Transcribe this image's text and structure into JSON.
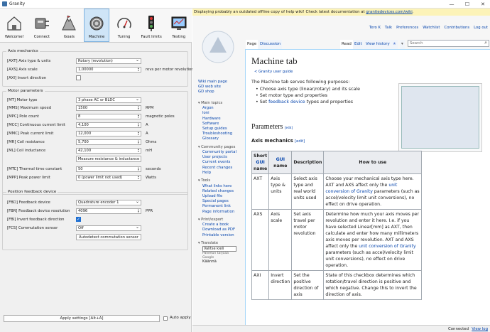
{
  "window": {
    "title": "Granity",
    "minimize": "—",
    "maximize": "☐",
    "close": "✕"
  },
  "toolbar": [
    {
      "label": "Welcome!",
      "icon": "welcome-icon"
    },
    {
      "label": "Connect",
      "icon": "connect-icon"
    },
    {
      "label": "Goals",
      "icon": "goals-icon"
    },
    {
      "label": "Machine",
      "icon": "machine-icon",
      "active": true
    },
    {
      "label": "Tuning",
      "icon": "tuning-icon"
    },
    {
      "label": "Fault limits",
      "icon": "traffic-light-icon"
    },
    {
      "label": "Testing",
      "icon": "testing-icon"
    }
  ],
  "axis": {
    "title": "Axis mechanics",
    "axt_label": "[AXT] Axis type & units",
    "axt_value": "Rotary (revolution)",
    "axs_label": "[AXS] Axis scale",
    "axs_value": "1,00000",
    "axs_unit": "revs per motor revolution",
    "axi_label": "[AXI] Invert direction"
  },
  "motor": {
    "title": "Motor parameters",
    "mt_label": "[MT] Motor type",
    "mt_value": "3 phase AC or BLDC",
    "mms_label": "[MMS] Maximum speed",
    "mms_value": "1500",
    "mms_unit": "RPM",
    "mpc_label": "[MPC] Pole count",
    "mpc_value": "8",
    "mpc_unit": "magnetic poles",
    "mcc_label": "[MCC] Continuous current limit",
    "mcc_value": "4,100",
    "mcc_unit": "A",
    "mmc_label": "[MMC] Peak current limit",
    "mmc_value": "12,000",
    "mmc_unit": "A",
    "mr_label": "[MR] Coil resistance",
    "mr_value": "5,700",
    "mr_unit": "Ohms",
    "ml_label": "[ML] Coil inductance",
    "ml_value": "42,100",
    "ml_unit": "mH",
    "measure_btn": "Measure resistance & inductance",
    "mtc_label": "[MTC] Thermal time constant",
    "mtc_value": "50",
    "mtc_unit": "seconds",
    "mpp_label": "[MPP] Peak power limit",
    "mpp_value": "0 (power limit not used)",
    "mpp_unit": "Watts"
  },
  "feedback": {
    "title": "Position feedback device",
    "fbd_label": "[FBD] Feedback device",
    "fbd_value": "Quadrature encoder 1",
    "fbr_label": "[FBR] Feedback device resolution",
    "fbr_value": "4096",
    "fbr_unit": "PPR",
    "fbi_label": "[FBI] Invert feedback direction",
    "fcs_label": "[FCS] Commutation sensor",
    "fcs_value": "Off",
    "autodetect_btn": "Autodetect commutation sensor"
  },
  "apply_btn": "Apply settings [Alt+A]",
  "auto_apply": "Auto apply",
  "notice": {
    "text": "Displaying probably an outdated offline copy of help wiki! Check latest documentation at ",
    "link": "granitedevices.com/wiki",
    "end": "."
  },
  "personal": [
    "Tero K",
    "Talk",
    "Preferences",
    "Watchlist",
    "Contributions",
    "Log out"
  ],
  "nav": {
    "top": [
      "Wiki main page",
      "GD web site",
      "GD shop"
    ],
    "main_h": "Main topics",
    "main": [
      "Argon",
      "Ioni",
      "Hardware",
      "Software",
      "Setup guides",
      "Troubleshooting",
      "Glossary"
    ],
    "comm_h": "Community pages",
    "comm": [
      "Community portal",
      "User projects",
      "Current events",
      "Recent changes",
      "Help"
    ],
    "tools_h": "Tools",
    "tools": [
      "What links here",
      "Related changes",
      "Upload file",
      "Special pages",
      "Permanent link",
      "Page information"
    ],
    "print_h": "Print/export",
    "print": [
      "Create a book",
      "Download as PDF",
      "Printable version"
    ],
    "trans_h": "Translate",
    "lang": "Valitse kieli",
    "powered": "Palvelun tarjoaa",
    "google": "Google",
    "kaanna": "Käännä"
  },
  "tabs": {
    "page": "Page",
    "discussion": "Discussion",
    "read": "Read",
    "edit": "Edit",
    "history": "View history",
    "star": "★",
    "more": "▾",
    "search": "Search"
  },
  "article": {
    "title": "Machine tab",
    "crumb": "< Granity user guide",
    "intro": "The Machine tab serves following purposes:",
    "b1": "Choose axis type (linear/rotary) and its scale",
    "b2": "Set motor type and properties",
    "b3a": "Set ",
    "b3link": "feedback device",
    "b3b": " types and properties",
    "h_params": "Parameters",
    "h_axis": "Axis mechanics",
    "edit": "[edit]",
    "th": [
      "Short GUI name",
      "GUI name",
      "Description",
      "How to use"
    ],
    "th_short_a": "Short",
    "th_short_b": "GUI",
    "th_short_c": "name",
    "rows": [
      {
        "s": "AXT",
        "g": "Axis type & units",
        "d": "Select axis type and real world units used",
        "h1": "Choose your mechanical axis type here. AXT and AXS affect only the ",
        "hl": "unit conversion of Granity",
        "h2": " parameters (such as accel/velocity limit unit conversions), no effect on drive operation."
      },
      {
        "s": "AXS",
        "g": "Axis scale",
        "d": "Set axis travel per motor revolution",
        "h1": "Determine how much your axis moves per revolution and enter it here. I.e. if you have selected Linear[mm] as AXT, then calculate and enter how many millimeters axis moves per revolution. AXT and AXS affect only the ",
        "hl": "unit conversion of Granity",
        "h2": " parameters (such as accel/velocity limit unit conversions), no effect on drive operation."
      },
      {
        "s": "AXI",
        "g": "Invert direction",
        "d": "Set the positive direction of axis",
        "h1": "State of this checkbox determines which rotation/travel direction is positive and which negative. Change this to invert the direction of axis.",
        "hl": "",
        "h2": ""
      }
    ]
  },
  "status": {
    "connected": "Connected",
    "viewlog": "View log"
  }
}
